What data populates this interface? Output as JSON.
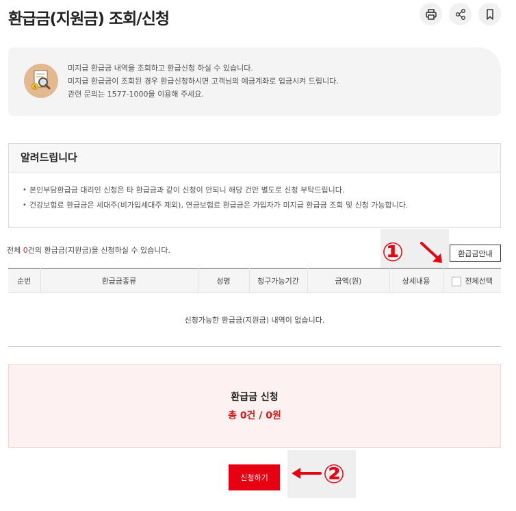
{
  "page": {
    "title": "환급금(지원금) 조회/신청"
  },
  "toolbar": {
    "print_icon": "print-icon",
    "share_icon": "share-icon",
    "bookmark_icon": "bookmark-icon"
  },
  "info": {
    "icon": "magnifier-document-icon",
    "lines": [
      "미지급 환급금 내역을 조회하고 환급신청 하실 수 있습니다.",
      "미지급 환급금이 조회된 경우 환급신청하시면 고객님의 예금계좌로 입금시켜 드립니다.",
      "관련 문의는 1577-1000을 이용해 주세요."
    ]
  },
  "notice": {
    "heading": "알려드립니다",
    "items": [
      "본인부담환급금 대리인 신청은 타 환급금과 같이 신청이 안되니 해당 건만 별도로 신청 부탁드립니다.",
      "건강보험료 환급금은 세대주(비가입세대주 제외), 연금보험료 환급금은 가입자가 미지급 환급금 조회 및 신청 가능합니다."
    ]
  },
  "summary": {
    "prefix": "전체 ",
    "count": "0",
    "suffix": "건의 환급금(지원금)을 신청하실 수 있습니다."
  },
  "guide_button": "환급금안내",
  "table": {
    "headers": [
      "순번",
      "환급금종류",
      "성명",
      "청구가능기간",
      "금액(원)",
      "상세내용",
      "전체선택"
    ],
    "empty_message": "신청가능한 환급금(지원금) 내역이 없습니다."
  },
  "apply": {
    "title": "환급금 신청",
    "total": "총 0건 / 0원"
  },
  "submit_button": "신청하기",
  "annotations": {
    "marker_1": "①",
    "marker_2": "②"
  },
  "colors": {
    "accent_red": "#e60012",
    "total_red": "#d61a1a",
    "apply_bg": "#fdf1f1",
    "info_bg": "#f4f4f4"
  }
}
